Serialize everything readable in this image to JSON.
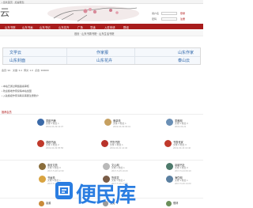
{
  "topbar": {
    "text": "• 您处首页 · 加速帮您"
  },
  "header": {
    "logo_char": "云"
  },
  "login": {
    "username_label": "用户名",
    "password_label": "密码",
    "login_action": "登录",
    "register_action": "注册"
  },
  "nav": {
    "items": [
      "山东书院",
      "山东书画",
      "山东书记",
      "山东花卉",
      "广场",
      "导读",
      "入驻申请",
      "群组"
    ]
  },
  "subnav": {
    "crumb": "首页 · 山东书香书院 · 山东生活书院"
  },
  "categories": {
    "row1": [
      "文学云",
      "作家报",
      "山东作家"
    ],
    "row2": [
      "山东封面",
      "山东花卉",
      "泰山云"
    ]
  },
  "stats": {
    "items": [
      "会员: 93",
      "文章: 3.4",
      "博文: 1.0",
      "点击: 300000"
    ]
  },
  "notices": [
    "• 本站已通过网络备案审核",
    "• 欢迎各地作家投稿本站加盟",
    "• 入驻各级作家请联系客服注册账户"
  ],
  "sections": {
    "members_title": "推荐会员",
    "new_title": "最新加入"
  },
  "cards": [
    {
      "name": "墨韵书斋",
      "meta": "文章 5  粉丝 1",
      "date": "2019-04-29 13:37"
    },
    {
      "name": "雅卓苑",
      "meta": "文章 3  粉丝 1",
      "date": "2019-04-09 09:01"
    },
    {
      "name": "墨雅阁",
      "meta": "文章 2  粉丝 0",
      "date": "2019-03-21"
    },
    {
      "name": "观峰书画",
      "meta": "文章 4  粉丝 2",
      "date": "2019-04-09 05:56"
    },
    {
      "name": "齐鲁书院",
      "meta": "文章 1  粉丝 1",
      "date": "2019-04-01 14:40"
    },
    {
      "name": "书香世家",
      "meta": "文章 6  粉丝 3",
      "date": "2019-03-16 13:40"
    },
    {
      "name": "泰安文苑",
      "meta": "文章 3  粉丝 0",
      "date": "2017-5-28 12:30"
    },
    {
      "name": "文心阁",
      "meta": "文章 2  粉丝 1",
      "date": "2017-5-25 10:20"
    },
    {
      "name": "泉城书社",
      "meta": "文章 4  粉丝 0",
      "date": "2017-5-24 09:10"
    },
    {
      "name": "书画苑",
      "meta": "文章 5  粉丝 1",
      "date": "2017-5-28 16:50"
    },
    {
      "name": "鲁风堂",
      "meta": "文章 1  粉丝 2",
      "date": "2017-5-26 17:05"
    },
    {
      "name": "海岱阁",
      "meta": "文章 3  粉丝 1",
      "date": "2017-5-26 14:20"
    }
  ],
  "footer_cards": [
    {
      "name": "泉源"
    },
    {
      "name": "文苑"
    },
    {
      "name": "儒林"
    }
  ],
  "watermark": {
    "text": "便民库"
  }
}
